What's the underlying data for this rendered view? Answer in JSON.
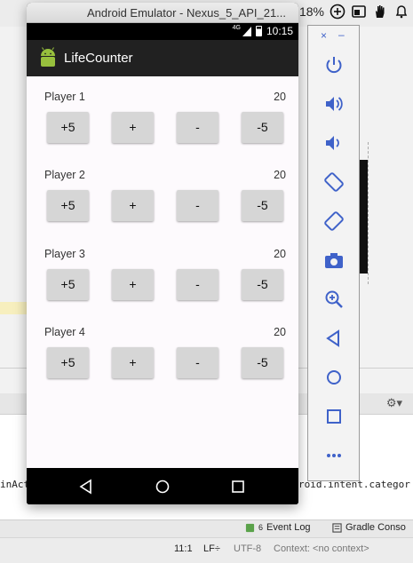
{
  "menubar": {
    "battery_pct": "18%",
    "icons": [
      "plus-circle-icon",
      "window-icon",
      "hand-icon",
      "bell-icon"
    ]
  },
  "emulator": {
    "window_title": "Android Emulator - Nexus_5_API_21...",
    "status": {
      "network": "4G",
      "time": "10:15"
    },
    "app": {
      "title": "LifeCounter",
      "players": [
        {
          "name": "Player 1",
          "life": "20",
          "buttons": [
            "+5",
            "+",
            "-",
            "-5"
          ]
        },
        {
          "name": "Player 2",
          "life": "20",
          "buttons": [
            "+5",
            "+",
            "-",
            "-5"
          ]
        },
        {
          "name": "Player 3",
          "life": "20",
          "buttons": [
            "+5",
            "+",
            "-",
            "-5"
          ]
        },
        {
          "name": "Player 4",
          "life": "20",
          "buttons": [
            "+5",
            "+",
            "-",
            "-5"
          ]
        }
      ]
    },
    "side_toolbar": {
      "close": "×",
      "minimize": "–",
      "buttons": [
        "power-icon",
        "volume-up-icon",
        "volume-down-icon",
        "rotate-left-icon",
        "rotate-right-icon",
        "camera-icon",
        "zoom-icon",
        "back-icon",
        "home-icon",
        "overview-icon",
        "more-icon"
      ]
    }
  },
  "ide": {
    "console_left": "inAct",
    "console_right": "roid.intent.categor",
    "tabs": {
      "event_log_count": "6",
      "event_log": "Event Log",
      "gradle_console": "Gradle Conso"
    },
    "statusbar": {
      "position": "11:1",
      "line_sep": "LF÷",
      "encoding": "UTF-8",
      "context": "Context: <no context>"
    }
  },
  "colors": {
    "toolbar": "#212121",
    "android_green": "#97c03d",
    "button_bg": "#d6d6d6",
    "side_toolbar_icon": "#3f62c9"
  }
}
